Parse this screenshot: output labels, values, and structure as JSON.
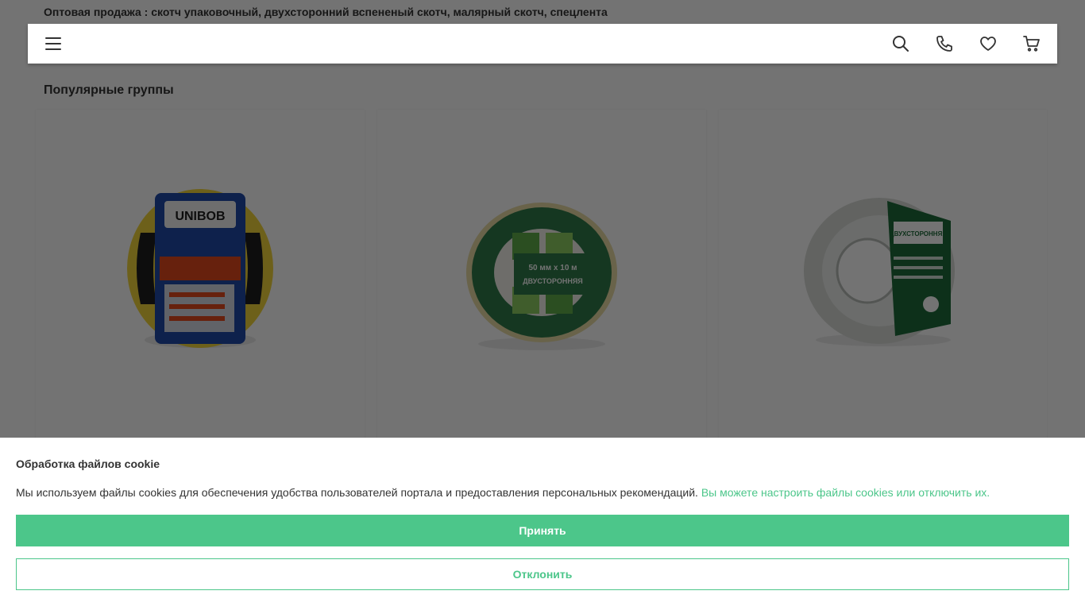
{
  "header": {
    "tagline": "Оптовая продажа : скотч упаковочный, двухсторонний вспененый скотч, малярный скотч, спецлента"
  },
  "navbar": {
    "icons": [
      "menu-icon",
      "search-icon",
      "phone-icon",
      "heart-icon",
      "cart-icon"
    ]
  },
  "popular": {
    "title": "Популярные группы",
    "groups": [
      {
        "image": "yellow-black-marking-tape"
      },
      {
        "image": "green-double-sided-tape-roll"
      },
      {
        "image": "thin-double-sided-foam-tape-roll"
      }
    ]
  },
  "cookie": {
    "title": "Обработка файлов cookie",
    "text": "Мы используем файлы cookies для обеспечения удобства пользователей портала и предоставления персональных рекомендаций.",
    "link": "Вы можете настроить файлы cookies или отключить их.",
    "accept_label": "Принять",
    "decline_label": "Отклонить"
  },
  "colors": {
    "accent": "#4cc68a",
    "overlay": "rgba(0,0,0,0.55)"
  }
}
